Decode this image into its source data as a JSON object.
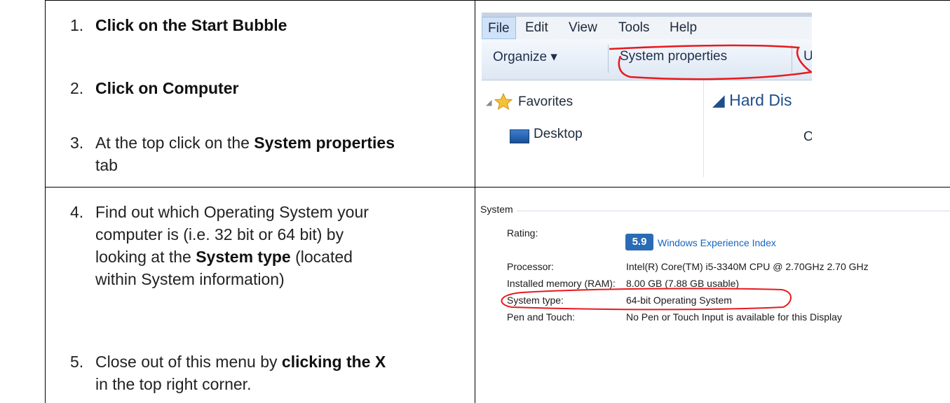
{
  "steps": [
    {
      "num": "1.",
      "lines": [
        [
          {
            "t": "Click on the Start Bubble",
            "b": true
          }
        ]
      ]
    },
    {
      "num": "2.",
      "lines": [
        [
          {
            "t": "Click on Computer",
            "b": true
          }
        ]
      ]
    },
    {
      "num": "3.",
      "lines": [
        [
          {
            "t": "At the top click on the ",
            "b": false
          },
          {
            "t": "System properties",
            "b": true
          }
        ],
        [
          {
            "t": "tab",
            "b": false
          }
        ]
      ]
    },
    {
      "num": "4.",
      "lines": [
        [
          {
            "t": "Find out which Operating System your",
            "b": false
          }
        ],
        [
          {
            "t": "computer is (i.e. 32 bit or 64 bit) by",
            "b": false
          }
        ],
        [
          {
            "t": "looking at the ",
            "b": false
          },
          {
            "t": "System type",
            "b": true
          },
          {
            "t": " (located",
            "b": false
          }
        ],
        [
          {
            "t": "within System information)",
            "b": false
          }
        ]
      ]
    },
    {
      "num": "5.",
      "lines": [
        [
          {
            "t": "Close out of this menu by ",
            "b": false
          },
          {
            "t": "clicking the X",
            "b": true
          }
        ],
        [
          {
            "t": "in the top right corner.",
            "b": false
          }
        ]
      ]
    }
  ],
  "explorer": {
    "menu": [
      "File",
      "Edit",
      "View",
      "Tools",
      "Help"
    ],
    "toolbar": {
      "organize": "Organize ▾",
      "system_properties": "System properties",
      "partial": "U"
    },
    "nav": {
      "favorites": "Favorites",
      "desktop": "Desktop"
    },
    "content": {
      "heading": "◢ Hard Dis",
      "partial": "O"
    },
    "annotation_color": "#e8191e"
  },
  "sysinfo": {
    "section": "System",
    "rows": [
      {
        "label": "Rating:",
        "value": "Windows Experience Index",
        "badge": "5.9",
        "link": true
      },
      {
        "label": "Processor:",
        "value": "Intel(R) Core(TM) i5-3340M CPU @ 2.70GHz   2.70 GHz"
      },
      {
        "label": "Installed memory (RAM):",
        "value": "8.00 GB (7.88 GB usable)"
      },
      {
        "label": "System type:",
        "value": "64-bit Operating System"
      },
      {
        "label": "Pen and Touch:",
        "value": "No Pen or Touch Input is available for this Display"
      }
    ],
    "annotation_color": "#e8191e"
  }
}
